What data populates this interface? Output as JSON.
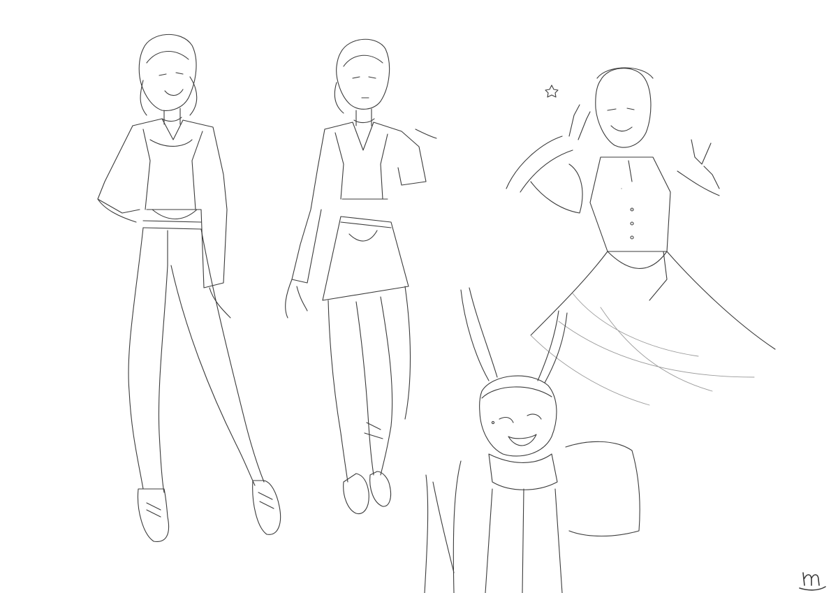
{
  "artwork": {
    "kind": "pencil character sketch sheet",
    "background": "#ffffff",
    "ink": "#3a3a3a",
    "figures": [
      {
        "name": "figure-jacket-jeans"
      },
      {
        "name": "figure-jacket-skirt"
      },
      {
        "name": "figure-dress-wink"
      },
      {
        "name": "figure-bunny-ears"
      }
    ],
    "signature": "m"
  }
}
